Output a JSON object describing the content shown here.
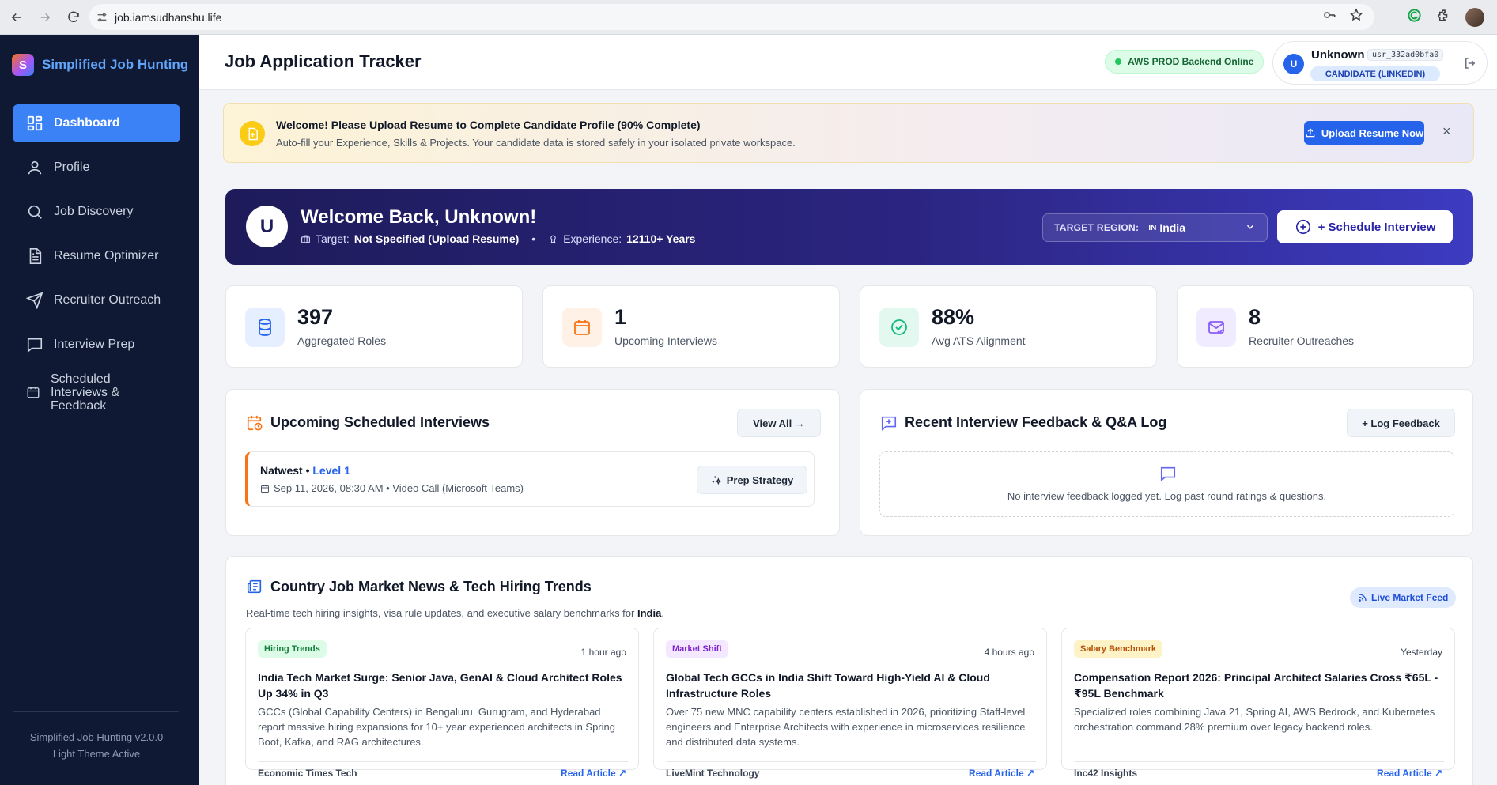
{
  "browser": {
    "url": "job.iamsudhanshu.life"
  },
  "sidebar": {
    "brand": "Simplified Job Hunting",
    "brand_letter": "S",
    "items": [
      {
        "label": "Dashboard",
        "icon": "dashboard-icon"
      },
      {
        "label": "Profile",
        "icon": "user-icon"
      },
      {
        "label": "Job Discovery",
        "icon": "search-icon"
      },
      {
        "label": "Resume Optimizer",
        "icon": "document-icon"
      },
      {
        "label": "Recruiter Outreach",
        "icon": "send-icon"
      },
      {
        "label": "Interview Prep",
        "icon": "chat-icon"
      },
      {
        "label": "Scheduled Interviews & Feedback",
        "icon": "calendar-icon"
      }
    ],
    "version": "Simplified Job Hunting v2.0.0",
    "theme": "Light Theme Active"
  },
  "header": {
    "title": "Job Application Tracker",
    "status": "AWS PROD Backend Online",
    "user_avatar": "U",
    "user_name": "Unknown",
    "user_id": "usr_332ad0bfa0",
    "user_role": "CANDIDATE (LINKEDIN)"
  },
  "banner": {
    "title": "Welcome! Please Upload Resume to Complete Candidate Profile (90% Complete)",
    "subtitle": "Auto-fill your Experience, Skills & Projects. Your candidate data is stored safely in your isolated private workspace.",
    "button": "Upload Resume Now",
    "close": "×"
  },
  "hero": {
    "avatar": "U",
    "title": "Welcome Back, Unknown!",
    "target_label": "Target:",
    "target_value": "Not Specified (Upload Resume)",
    "sep": "•",
    "experience_label": "Experience:",
    "experience_value": "12110+ Years",
    "region_label": "TARGET REGION:",
    "region_flag": "IN",
    "region_value": "India",
    "schedule_button": "+ Schedule Interview"
  },
  "stats": [
    {
      "value": "397",
      "label": "Aggregated Roles",
      "icon": "database-icon",
      "color": "#2563eb",
      "bg": "#e6efff"
    },
    {
      "value": "1",
      "label": "Upcoming Interviews",
      "icon": "calendar-icon",
      "color": "#f97316",
      "bg": "#fff1e6"
    },
    {
      "value": "88%",
      "label": "Avg ATS Alignment",
      "icon": "check-circle-icon",
      "color": "#10b981",
      "bg": "#e3f8ef"
    },
    {
      "value": "8",
      "label": "Recruiter Outreaches",
      "icon": "mail-check-icon",
      "color": "#8b5cf6",
      "bg": "#f1ebff"
    }
  ],
  "upcoming": {
    "title": "Upcoming Scheduled Interviews",
    "view_all": "View All →",
    "interview": {
      "company": "Natwest",
      "dot": " • ",
      "level": "Level 1",
      "when": "Sep 11, 2026, 08:30 AM • Video Call (Microsoft Teams)",
      "prep_button": "Prep Strategy"
    }
  },
  "feedback": {
    "title": "Recent Interview Feedback & Q&A Log",
    "log_button": "+ Log Feedback",
    "empty": "No interview feedback logged yet. Log past round ratings & questions."
  },
  "news": {
    "title": "Country Job Market News & Tech Hiring Trends",
    "subtitle_prefix": "Real-time tech hiring insights, visa rule updates, and executive salary benchmarks for ",
    "subtitle_country": "India",
    "subtitle_suffix": ".",
    "live_feed": "Live Market Feed",
    "articles": [
      {
        "tag": "Hiring Trends",
        "tag_color": "#15803d",
        "tag_bg": "#dcfce7",
        "time": "1 hour ago",
        "title": "India Tech Market Surge: Senior Java, GenAI & Cloud Architect Roles Up 34% in Q3",
        "body": "GCCs (Global Capability Centers) in Bengaluru, Gurugram, and Hyderabad report massive hiring expansions for 10+ year experienced architects in Spring Boot, Kafka, and RAG architectures.",
        "source": "Economic Times Tech",
        "link": "Read Article ↗"
      },
      {
        "tag": "Market Shift",
        "tag_color": "#7e22ce",
        "tag_bg": "#f3e8ff",
        "time": "4 hours ago",
        "title": "Global Tech GCCs in India Shift Toward High-Yield AI & Cloud Infrastructure Roles",
        "body": "Over 75 new MNC capability centers established in 2026, prioritizing Staff-level engineers and Enterprise Architects with experience in microservices resilience and distributed data systems.",
        "source": "LiveMint Technology",
        "link": "Read Article ↗"
      },
      {
        "tag": "Salary Benchmark",
        "tag_color": "#b45309",
        "tag_bg": "#fef3c7",
        "time": "Yesterday",
        "title": "Compensation Report 2026: Principal Architect Salaries Cross ₹65L - ₹95L Benchmark",
        "body": "Specialized roles combining Java 21, Spring AI, AWS Bedrock, and Kubernetes orchestration command 28% premium over legacy backend roles.",
        "source": "Inc42 Insights",
        "link": "Read Article ↗"
      }
    ]
  }
}
